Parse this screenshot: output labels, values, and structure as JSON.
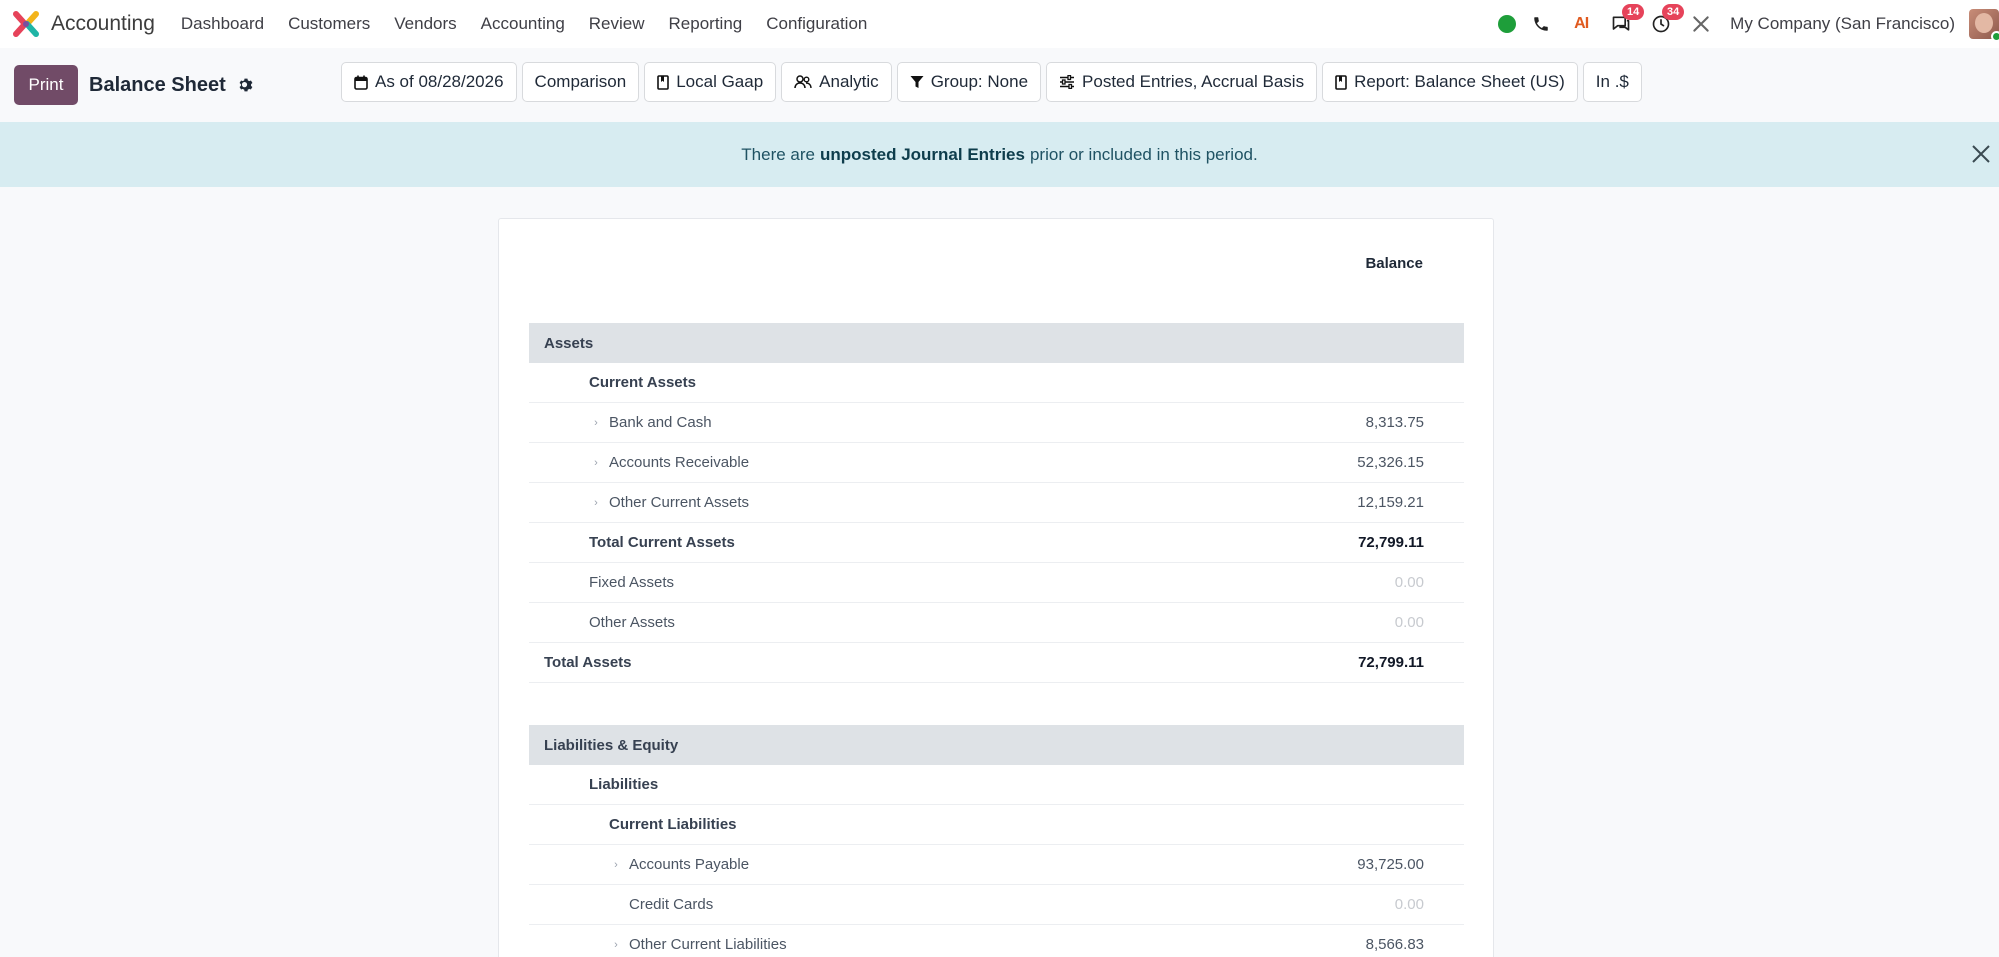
{
  "navbar": {
    "app_title": "Accounting",
    "menu": [
      "Dashboard",
      "Customers",
      "Vendors",
      "Accounting",
      "Review",
      "Reporting",
      "Configuration"
    ],
    "ai_label": "AI",
    "messages_count": "14",
    "activities_count": "34",
    "company": "My Company (San Francisco)"
  },
  "control": {
    "print_label": "Print",
    "report_title": "Balance Sheet",
    "filters": {
      "date": "As of 08/28/2026",
      "comparison": "Comparison",
      "local_gaap": "Local Gaap",
      "analytic": "Analytic",
      "group": "Group: None",
      "posted": "Posted Entries, Accrual Basis",
      "report": "Report: Balance Sheet (US)",
      "currency": "In .$"
    }
  },
  "alert": {
    "prefix": "There are",
    "link": "unposted Journal Entries",
    "suffix": "prior or included in this period."
  },
  "report": {
    "column_header": "Balance",
    "assets": {
      "section": "Assets",
      "current_assets": "Current Assets",
      "bank_cash": {
        "label": "Bank and Cash",
        "value": "8,313.75"
      },
      "receivable": {
        "label": "Accounts Receivable",
        "value": "52,326.15"
      },
      "other_current": {
        "label": "Other Current Assets",
        "value": "12,159.21"
      },
      "total_current": {
        "label": "Total Current Assets",
        "value": "72,799.11"
      },
      "fixed": {
        "label": "Fixed Assets",
        "value": "0.00"
      },
      "other": {
        "label": "Other Assets",
        "value": "0.00"
      },
      "total": {
        "label": "Total Assets",
        "value": "72,799.11"
      }
    },
    "liabilities": {
      "section": "Liabilities & Equity",
      "liabilities": "Liabilities",
      "current_liabilities": "Current Liabilities",
      "payable": {
        "label": "Accounts Payable",
        "value": "93,725.00"
      },
      "credit_cards": {
        "label": "Credit Cards",
        "value": "0.00"
      },
      "other_current": {
        "label": "Other Current Liabilities",
        "value": "8,566.83"
      }
    }
  },
  "colors": {
    "brand": "#714b67",
    "alert_bg": "#d7ecf1",
    "badge": "#e6435a",
    "online": "#1e9e3a"
  }
}
